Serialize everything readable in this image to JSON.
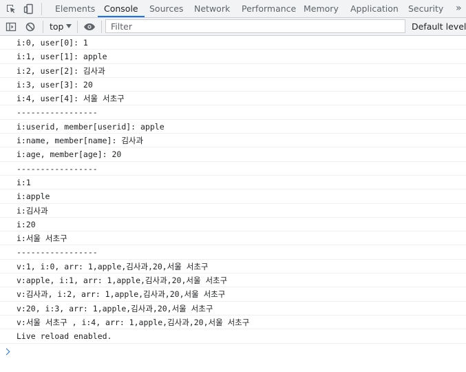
{
  "tabs": [
    {
      "label": "Elements",
      "active": false
    },
    {
      "label": "Console",
      "active": true
    },
    {
      "label": "Sources",
      "active": false
    },
    {
      "label": "Network",
      "active": false
    },
    {
      "label": "Performance",
      "active": false
    },
    {
      "label": "Memory",
      "active": false
    },
    {
      "label": "Application",
      "active": false
    },
    {
      "label": "Security",
      "active": false
    }
  ],
  "more_tabs_glyph": "»",
  "toolbar": {
    "context": "top",
    "filter_placeholder": "Filter",
    "levels_label": "Default levels"
  },
  "console_lines": [
    "i:0, user[0]: 1",
    "i:1, user[1]: apple",
    "i:2, user[2]: 김사과",
    "i:3, user[3]: 20",
    "i:4, user[4]: 서울 서초구",
    "-----------------",
    "i:userid, member[userid]: apple",
    "i:name, member[name]: 김사과",
    "i:age, member[age]: 20",
    "-----------------",
    "i:1",
    "i:apple",
    "i:김사과",
    "i:20",
    "i:서울 서초구",
    "-----------------",
    "v:1, i:0, arr: 1,apple,김사과,20,서울 서초구",
    "v:apple, i:1, arr: 1,apple,김사과,20,서울 서초구",
    "v:김사과, i:2, arr: 1,apple,김사과,20,서울 서초구",
    "v:20, i:3, arr: 1,apple,김사과,20,서울 서초구",
    "v:서울 서초구 , i:4, arr: 1,apple,김사과,20,서울 서초구",
    "Live reload enabled."
  ],
  "colors": {
    "accent": "#1a73e8",
    "toolbar_bg": "#f1f3f4",
    "border": "#cbcdd1"
  }
}
